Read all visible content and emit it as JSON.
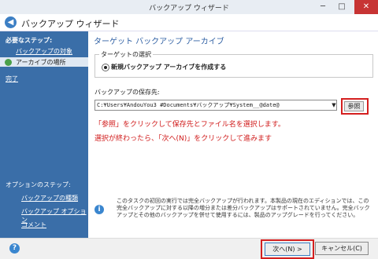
{
  "window": {
    "title": "バックアップ ウィザード",
    "minimize": "─",
    "maximize": "□",
    "close": "✕"
  },
  "header": {
    "title": "バックアップ ウィザード",
    "back_icon": "arrow-left-icon"
  },
  "sidebar": {
    "required_heading": "必要なステップ:",
    "items": [
      {
        "label": "バックアップの対象"
      },
      {
        "label": "アーカイブの場所",
        "current": true
      },
      {
        "label": "完了"
      }
    ],
    "optional_heading": "オプションのステップ:",
    "optional_items": [
      {
        "label": "バックアップの種類"
      },
      {
        "label": "バックアップ オプション"
      },
      {
        "label": "コメント"
      }
    ]
  },
  "main": {
    "title": "ターゲット バックアップ アーカイブ",
    "target_group": {
      "legend": "ターゲットの選択",
      "radio_label": "新規バックアップ アーカイブを作成する"
    },
    "save_location_label": "バックアップの保存先:",
    "path_value": "C:¥Users¥AndouYou3 #Documents¥バックアップ¥System__@date@",
    "browse_label": "参照",
    "instruction_1": "「参照」をクリックして保存先とファイル名を選択します。",
    "instruction_2": "選択が終わったら、「次へ(N)」をクリックして進みます",
    "note": "このタスクの初回の実行では完全バックアップが行われます。本製品の現在のエディションでは、この完全バックアップに対する以降の増分または差分バックアップはサポートされていません。完全バックアップとその他のバックアップを併せて使用するには、製品のアップグレードを行ってください。"
  },
  "footer": {
    "help_icon": "?",
    "next_label": "次へ(N) >",
    "cancel_label": "キャンセル(C)"
  },
  "colors": {
    "sidebar": "#3a6ea8",
    "accent": "#2e5fa3",
    "highlight": "#d41f1f"
  }
}
